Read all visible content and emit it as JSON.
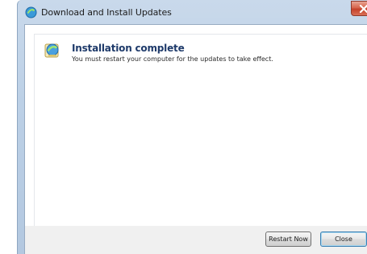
{
  "window": {
    "title": "Download and Install Updates"
  },
  "status": {
    "heading": "Installation complete",
    "message": "You must restart your computer for the updates to take effect."
  },
  "buttons": {
    "restart_label": "Restart Now",
    "close_label": "Close"
  },
  "icons": {
    "app": "windows-update-icon",
    "status": "windows-update-icon",
    "close": "close-icon"
  },
  "colors": {
    "heading": "#1e3a6a",
    "close_button": "#c4412a",
    "titlebar": "#bcd0e6"
  }
}
